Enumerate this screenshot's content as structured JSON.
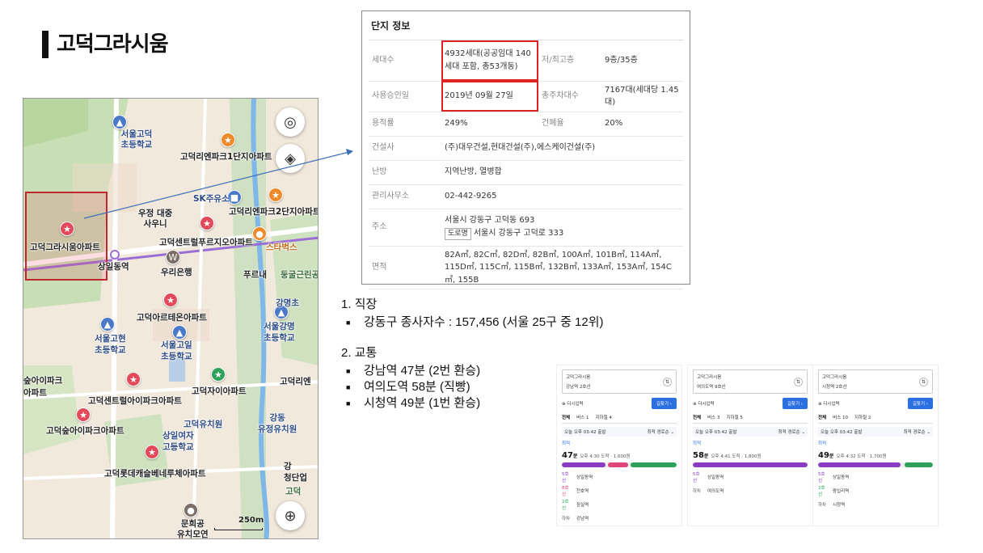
{
  "title": "고덕그라시움",
  "map": {
    "labels": {
      "school1": "서울고덕\n초등학교",
      "apt1": "고덕리엔파크1단지아파트",
      "sk": "SK주유소",
      "apt2": "고덕리엔파크2단지아파트",
      "post": "우정 대중\n사우니",
      "grasium": "고덕그라시움아파트",
      "central": "고덕센트럴푸르지오아파트",
      "starbucks": "스타벅스",
      "station": "상일동역",
      "bank": "우리은행",
      "purunae": "푸르내",
      "park": "둥굴근린공",
      "gangmyeong": "강명초",
      "areuteon": "고덕아르테온아파트",
      "school2": "서울고현\n초등학교",
      "school3": "서울고일\n초등학교",
      "school4": "서울강명\n초등학교",
      "amapark": "숲아이파크\n아파트",
      "zai": "고덕자이아파트",
      "rien3": "고덕리엔",
      "centrum": "고덕센트럴아이파크아파트",
      "gangdong": "강동\n유정유치원",
      "aipark": "고덕숲아이파크아파트",
      "kinder": "고덕유치원",
      "girls": "상일여자\n고등학교",
      "lotte": "고덕롯데캐슬베네루체아파트",
      "munhwa": "문희공\n유치모연",
      "gang2": "강\n청단업",
      "gong": "고덕",
      "scale": "250m"
    }
  },
  "info": {
    "header": "단지 정보",
    "rows": [
      {
        "k1": "세대수",
        "v1": "4932세대(공공임대 140세대 포함, 총53개동)",
        "k2": "저/최고층",
        "v2": "9층/35층"
      },
      {
        "k1": "사용승인일",
        "v1": "2019년 09월 27일",
        "k2": "총주차대수",
        "v2": "7167대(세대당 1.45대)"
      },
      {
        "k1": "용적률",
        "v1": "249%",
        "k2": "건폐율",
        "v2": "20%"
      },
      {
        "k1": "건설사",
        "v1": "(주)대우건설,현대건설(주),에스케이건설(주)"
      },
      {
        "k1": "난방",
        "v1": "지역난방, 열병합"
      },
      {
        "k1": "관리사무소",
        "v1": "02-442-9265"
      },
      {
        "k1": "주소",
        "v1": "서울시 강동구 고덕동 693",
        "badge": "도로명",
        "v1b": "서울시 강동구 고덕로 333"
      },
      {
        "k1": "면적",
        "v1": "82A㎡, 82C㎡, 82D㎡, 82B㎡, 100A㎡, 101B㎡, 114A㎡, 115D㎡, 115C㎡, 115B㎡, 132B㎡, 133A㎡, 153A㎡, 154C㎡, 155B"
      }
    ]
  },
  "notes": {
    "h1": "1. 직장",
    "i1": "강동구 종사자수 : 157,456 (서울 25구 중 12위)",
    "h2": "2. 교통",
    "i2": "강남역 47분 (2번 환승)",
    "i3": "여의도역 58분 (직빵)",
    "i4": "시청역 49분 (1번 환승)"
  },
  "routes": [
    {
      "from": "고덕그라시움",
      "to": "강남역 2호선",
      "btn": "길찾기 ›",
      "tabs": [
        "전체",
        "버스 1",
        "지하철 4"
      ],
      "sub": "오늘 오후 03:42 출발",
      "sort": "최적 경로순 ⌄",
      "tag": "최적",
      "time": "47",
      "unit": "분",
      "detail": "오후 4:30 도착 · 1,600원",
      "steps": [
        "상일동역",
        "천호역",
        "잠실역",
        "강남역"
      ],
      "lines": [
        "5호선",
        "8호선",
        "2호선",
        "하차"
      ]
    },
    {
      "from": "고덕그라시움",
      "to": "여의도역 9호선",
      "btn": "길찾기 ›",
      "tabs": [
        "전체",
        "버스 3",
        "지하철 5"
      ],
      "sub": "오늘 오후 03:42 출발",
      "sort": "최적 경로순 ⌄",
      "tag": "최적",
      "time": "58",
      "unit": "분",
      "detail": "오후 4:41 도착 · 1,800원",
      "steps": [
        "상일동역",
        "여의도역"
      ],
      "lines": [
        "5호선",
        "하차"
      ]
    },
    {
      "from": "고덕그라시움",
      "to": "시청역 2호선",
      "btn": "길찾기 ›",
      "tabs": [
        "전체",
        "버스 10",
        "지하철 2"
      ],
      "sub": "오늘 오후 03:42 출발",
      "sort": "최적 경로순 ⌄",
      "tag": "최적",
      "time": "49",
      "unit": "분",
      "detail": "오후 4:32 도착 · 1,700원",
      "steps": [
        "상일동역",
        "왕십리역",
        "시청역"
      ],
      "lines": [
        "5호선",
        "2호선",
        "하차"
      ]
    }
  ],
  "colors": {
    "accent": "#2b6fe0",
    "pin_red": "#e2495a",
    "line5": "#8a3cc4",
    "line2": "#2ea25a",
    "line8": "#e0457b",
    "highlight": "#c0262c"
  }
}
